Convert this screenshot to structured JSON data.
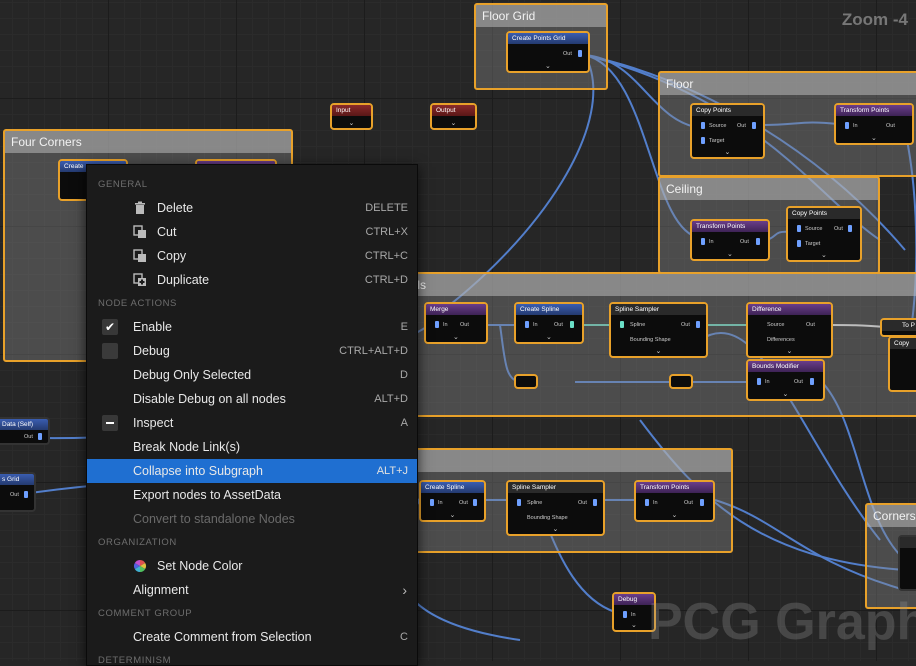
{
  "canvas": {
    "zoom_label": "Zoom -4",
    "watermark": "PCG Graph",
    "comments": [
      {
        "id": "floor-grid",
        "title": "Floor Grid"
      },
      {
        "id": "four-corners",
        "title": "Four Corners"
      },
      {
        "id": "floor",
        "title": "Floor"
      },
      {
        "id": "ceiling",
        "title": "Ceiling"
      },
      {
        "id": "walls",
        "title": "alls"
      },
      {
        "id": "spline-group",
        "title": ""
      },
      {
        "id": "corners",
        "title": "Corners"
      }
    ],
    "nodes": {
      "input": "Input",
      "output": "Output",
      "create_points_grid": "Create Points Grid",
      "create_left": "Create",
      "floor_copy_points": "Copy Points",
      "floor_transform_points": "Transform Points",
      "ceiling_transform_points": "Transform Points",
      "ceiling_copy_points": "Copy Points",
      "merge": "Merge",
      "create_spline_1": "Create Spline",
      "spline_sampler_1": "Spline Sampler",
      "difference": "Difference",
      "bounds_modifier": "Bounds Modifier",
      "to_point": "To P",
      "copy_right": "Copy",
      "create_spline_2": "Create Spline",
      "spline_sampler_2": "Spline Sampler",
      "transform_points_3": "Transform Points",
      "debug": "Debug",
      "data_self": "Data (Self)",
      "s_grid": "s Grid"
    },
    "pins": {
      "out": "Out",
      "in": "In",
      "source": "Source",
      "target": "Target",
      "spline": "Spline",
      "bounding_shape": "Bounding Shape",
      "differences": "Differences"
    }
  },
  "menu": {
    "sections": {
      "general": "GENERAL",
      "node_actions": "NODE ACTIONS",
      "organization": "ORGANIZATION",
      "comment_group": "COMMENT GROUP",
      "determinism": "DETERMINISM"
    },
    "items": {
      "delete": {
        "label": "Delete",
        "shortcut": "DELETE"
      },
      "cut": {
        "label": "Cut",
        "shortcut": "CTRL+X"
      },
      "copy": {
        "label": "Copy",
        "shortcut": "CTRL+C"
      },
      "duplicate": {
        "label": "Duplicate",
        "shortcut": "CTRL+D"
      },
      "enable": {
        "label": "Enable",
        "shortcut": "E"
      },
      "debug": {
        "label": "Debug",
        "shortcut": "CTRL+ALT+D"
      },
      "debug_only_selected": {
        "label": "Debug Only Selected",
        "shortcut": "D"
      },
      "disable_debug_all": {
        "label": "Disable Debug on all nodes",
        "shortcut": "ALT+D"
      },
      "inspect": {
        "label": "Inspect",
        "shortcut": "A"
      },
      "break_links": {
        "label": "Break Node Link(s)",
        "shortcut": ""
      },
      "collapse_subgraph": {
        "label": "Collapse into Subgraph",
        "shortcut": "ALT+J"
      },
      "export_nodes": {
        "label": "Export nodes to AssetData",
        "shortcut": ""
      },
      "convert_standalone": {
        "label": "Convert to standalone Nodes",
        "shortcut": ""
      },
      "set_node_color": {
        "label": "Set Node Color",
        "shortcut": ""
      },
      "alignment": {
        "label": "Alignment",
        "shortcut": ""
      },
      "create_comment": {
        "label": "Create Comment from Selection",
        "shortcut": "C"
      }
    },
    "state": {
      "enable_checked": true,
      "debug_checked": false,
      "inspect_state": "indeterminate",
      "highlighted": "collapse_subgraph"
    }
  },
  "colors": {
    "selection_orange": "#e8a12a",
    "wire_blue": "#5a8ee8",
    "highlight": "#1f6fd1"
  }
}
